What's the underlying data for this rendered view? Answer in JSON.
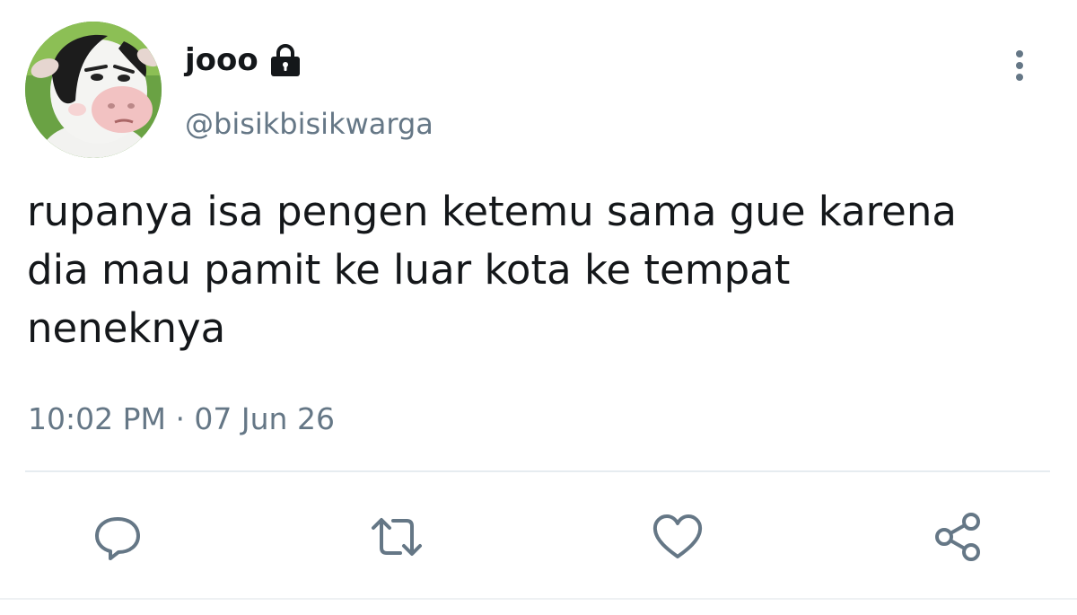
{
  "tweet": {
    "display_name": "jooo",
    "username": "@bisikbisikwarga",
    "text": "rupanya isa pengen ketemu sama gue karena\ndia mau pamit ke luar kota ke tempat\nneneknya",
    "timestamp": "10:02 PM · 07 Jun 26",
    "protected_icon": "lock-icon",
    "avatar_icon": "cartoon-cow-avatar"
  },
  "menu": {
    "more_icon": "vertical-dots-icon"
  },
  "actions": [
    {
      "name": "reply",
      "icon": "comment-bubble-icon"
    },
    {
      "name": "retweet",
      "icon": "retweet-arrows-icon"
    },
    {
      "name": "like",
      "icon": "heart-icon"
    },
    {
      "name": "share",
      "icon": "share-nodes-icon"
    }
  ],
  "colors": {
    "text_primary": "#14171a",
    "text_secondary": "#657786",
    "icon_gray": "#657786",
    "divider": "#e6ecf0"
  }
}
